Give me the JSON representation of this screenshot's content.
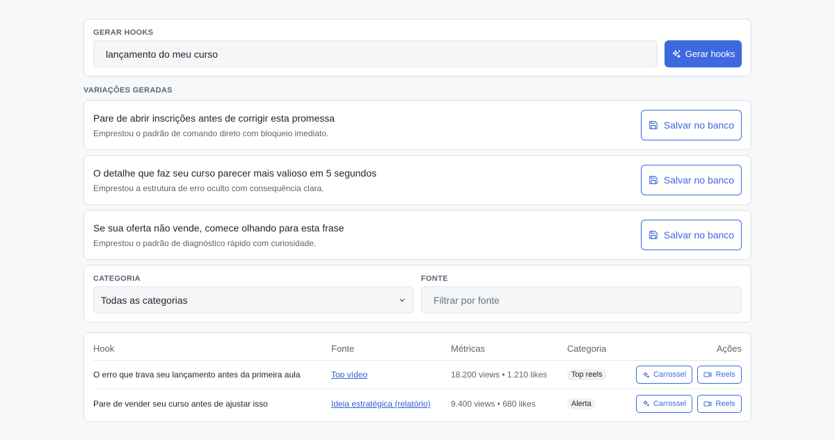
{
  "generate": {
    "section_label": "GERAR HOOKS",
    "input_value": "lançamento do meu curso",
    "button_label": "Gerar hooks"
  },
  "variations": {
    "section_label": "VARIAÇÕES GERADAS",
    "items": [
      {
        "title": "Pare de abrir inscrições antes de corrigir esta promessa",
        "subtitle": "Emprestou o padrão de comando direto com bloqueio imediato.",
        "button_label": "Salvar no banco"
      },
      {
        "title": "O detalhe que faz seu curso parecer mais valioso em 5 segundos",
        "subtitle": "Emprestou a estrutura de erro oculto com consequência clara.",
        "button_label": "Salvar no banco"
      },
      {
        "title": "Se sua oferta não vende, comece olhando para esta frase",
        "subtitle": "Emprestou o padrão de diagnóstico rápido com curiosidade.",
        "button_label": "Salvar no banco"
      }
    ]
  },
  "filters": {
    "category_label": "CATEGORIA",
    "category_value": "Todas as categorias",
    "source_label": "FONTE",
    "source_placeholder": "Filtrar por fonte"
  },
  "table": {
    "headers": {
      "hook": "Hook",
      "source": "Fonte",
      "metrics": "Métricas",
      "category": "Categoria",
      "actions": "Ações"
    },
    "rows": [
      {
        "hook": "O erro que trava seu lançamento antes da primeira aula",
        "source": "Top vídeo",
        "metrics": "18.200 views • 1.210 likes",
        "category": "Top reels",
        "carousel_label": "Carrossel",
        "reels_label": "Reels"
      },
      {
        "hook": "Pare de vender seu curso antes de ajustar isso",
        "source": "Ideia estratégica (relatório)",
        "metrics": "9.400 views • 680 likes",
        "category": "Alerta",
        "carousel_label": "Carrossel",
        "reels_label": "Reels"
      }
    ]
  },
  "colors": {
    "accent": "#3d68e0",
    "background": "#f7f8fa",
    "card": "#ffffff"
  }
}
